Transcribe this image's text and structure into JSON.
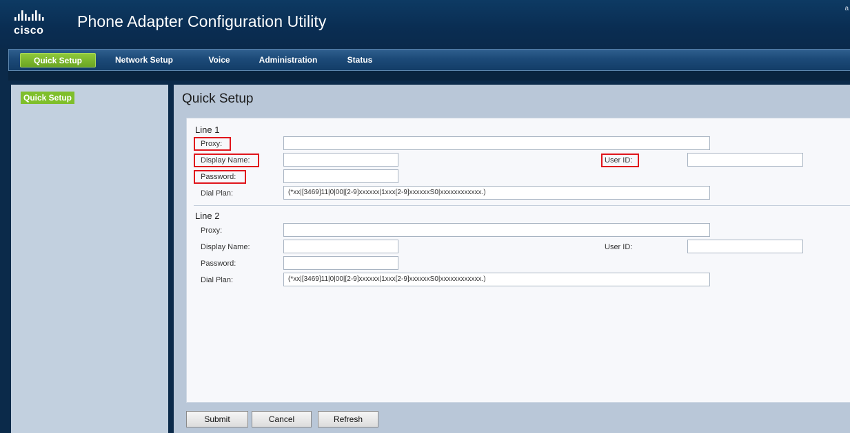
{
  "app": {
    "title": "Phone Adapter Configuration Utility",
    "brand": "cisco",
    "corner_text": "a"
  },
  "nav": {
    "tabs": [
      {
        "label": "Quick Setup",
        "active": true
      },
      {
        "label": "Network Setup",
        "active": false
      },
      {
        "label": "Voice",
        "active": false
      },
      {
        "label": "Administration",
        "active": false
      },
      {
        "label": "Status",
        "active": false
      }
    ]
  },
  "sidebar": {
    "items": [
      {
        "label": "Quick Setup",
        "active": true
      }
    ]
  },
  "page": {
    "title": "Quick Setup"
  },
  "line1": {
    "title": "Line 1",
    "proxy_label": "Proxy:",
    "proxy_value": "",
    "display_name_label": "Display Name:",
    "display_name_value": "",
    "user_id_label": "User ID:",
    "user_id_value": "",
    "password_label": "Password:",
    "password_value": "",
    "dial_plan_label": "Dial Plan:",
    "dial_plan_value": "(*xx|[3469]11|0|00|[2-9]xxxxxx|1xxx[2-9]xxxxxxS0|xxxxxxxxxxxx.)"
  },
  "line2": {
    "title": "Line 2",
    "proxy_label": "Proxy:",
    "proxy_value": "",
    "display_name_label": "Display Name:",
    "display_name_value": "",
    "user_id_label": "User ID:",
    "user_id_value": "",
    "password_label": "Password:",
    "password_value": "",
    "dial_plan_label": "Dial Plan:",
    "dial_plan_value": "(*xx|[3469]11|0|00|[2-9]xxxxxx|1xxx[2-9]xxxxxxS0|xxxxxxxxxxxx.)"
  },
  "buttons": {
    "submit": "Submit",
    "cancel": "Cancel",
    "refresh": "Refresh"
  },
  "highlighted_fields": [
    "Proxy:",
    "Display Name:",
    "Password:",
    "User ID:"
  ],
  "colors": {
    "header_bg": "#0d3a63",
    "accent_green": "#7fbf2b",
    "highlight_red": "#e0141b",
    "main_bg": "#b9c7d8",
    "sidebar_bg": "#c2d0df"
  },
  "icons": {
    "logo": "cisco-logo"
  }
}
